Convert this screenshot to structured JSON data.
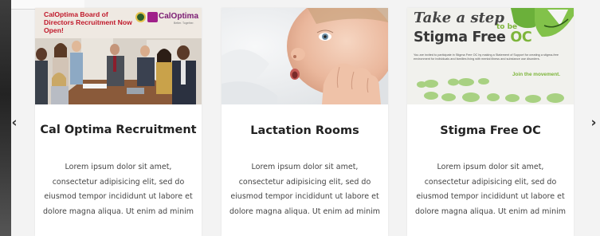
{
  "carousel": {
    "prev_icon": "‹",
    "next_icon": "›"
  },
  "cards": [
    {
      "title": "Cal Optima Recruitment",
      "body": "Lorem ipsum dolor sit amet, consectetur adipisicing elit, sed do eiusmod tempor incididunt ut labore et dolore magna aliqua. Ut enim ad minim",
      "image": {
        "banner_text": "CalOptima Board of Directors Recruitment Now Open!",
        "logo_text": "CalOptima",
        "logo_tagline": "Better. Together."
      }
    },
    {
      "title": "Lactation Rooms",
      "body": "Lorem ipsum dolor sit amet, consectetur adipisicing elit, sed do eiusmod tempor incididunt ut labore et dolore magna aliqua. Ut enim ad minim",
      "image": {}
    },
    {
      "title": "Stigma Free OC",
      "body": "Lorem ipsum dolor sit amet, consectetur adipisicing elit, sed do eiusmod tempor incididunt ut labore et dolore magna aliqua. Ut enim ad minim",
      "image": {
        "headline_1": "Take a step",
        "headline_2": "to be",
        "headline_3": "Stigma Free",
        "headline_4": "OC",
        "fine_print": "You are invited to participate in Stigma Free OC by making a Statement of Support for creating a stigma-free environment for individuals and families living with mental illness and substance use disorders.",
        "cta": "Join the movement."
      }
    }
  ],
  "colors": {
    "background": "#f3f3f3",
    "card": "#ffffff",
    "calOptimaRed": "#c0182a",
    "calOptimaPurple": "#7a1a72",
    "stigmaGreen": "#7db53b"
  }
}
